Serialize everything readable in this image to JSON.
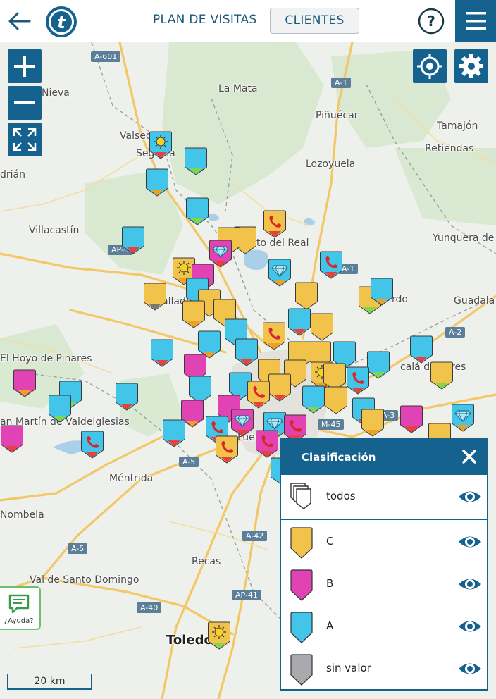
{
  "header": {
    "plan_label": "PLAN DE VISITAS",
    "clients_label": "CLIENTES",
    "help_symbol": "?",
    "logo_letter": "t"
  },
  "map": {
    "places": [
      "La Mata",
      "Piñuécar",
      "Tamajón",
      "Retiendas",
      "Nieva",
      "Valseca",
      "Segovia",
      "drián",
      "Lozoyuela",
      "Villacastín",
      "Yunquera de",
      "to del Real",
      "Guadala",
      "El Hoyo de Pinares",
      "an Martín de Valdeiglesias",
      "Méntrida",
      "Nombela",
      "Recas",
      "Val de Santo Domingo",
      "Toledo",
      "Fuen",
      "allado",
      "calá de H",
      "res",
      "rdo"
    ],
    "roads": [
      "A-601",
      "A-1",
      "AP-6",
      "A-1",
      "A-2",
      "A-5",
      "M-45",
      "A-3",
      "A-42",
      "A-5",
      "AP-41",
      "A-40"
    ],
    "scale_label": "20 km"
  },
  "help": {
    "label": "¿Ayuda?"
  },
  "legend": {
    "title": "Clasificación",
    "all_label": "todos",
    "items": [
      {
        "label": "C",
        "color": "#f1c34b"
      },
      {
        "label": "B",
        "color": "#e243b4"
      },
      {
        "label": "A",
        "color": "#43c5ea"
      },
      {
        "label": "sin valor",
        "color": "#a9aaad"
      }
    ]
  },
  "marker_colors": {
    "C": "#f1c34b",
    "B": "#e243b4",
    "A": "#43c5ea",
    "none": "#a9aaad",
    "tip_red": "#e8403c",
    "tip_green": "#7dd84a",
    "tip_orange": "#f0a020",
    "tip_gray": "#777"
  }
}
